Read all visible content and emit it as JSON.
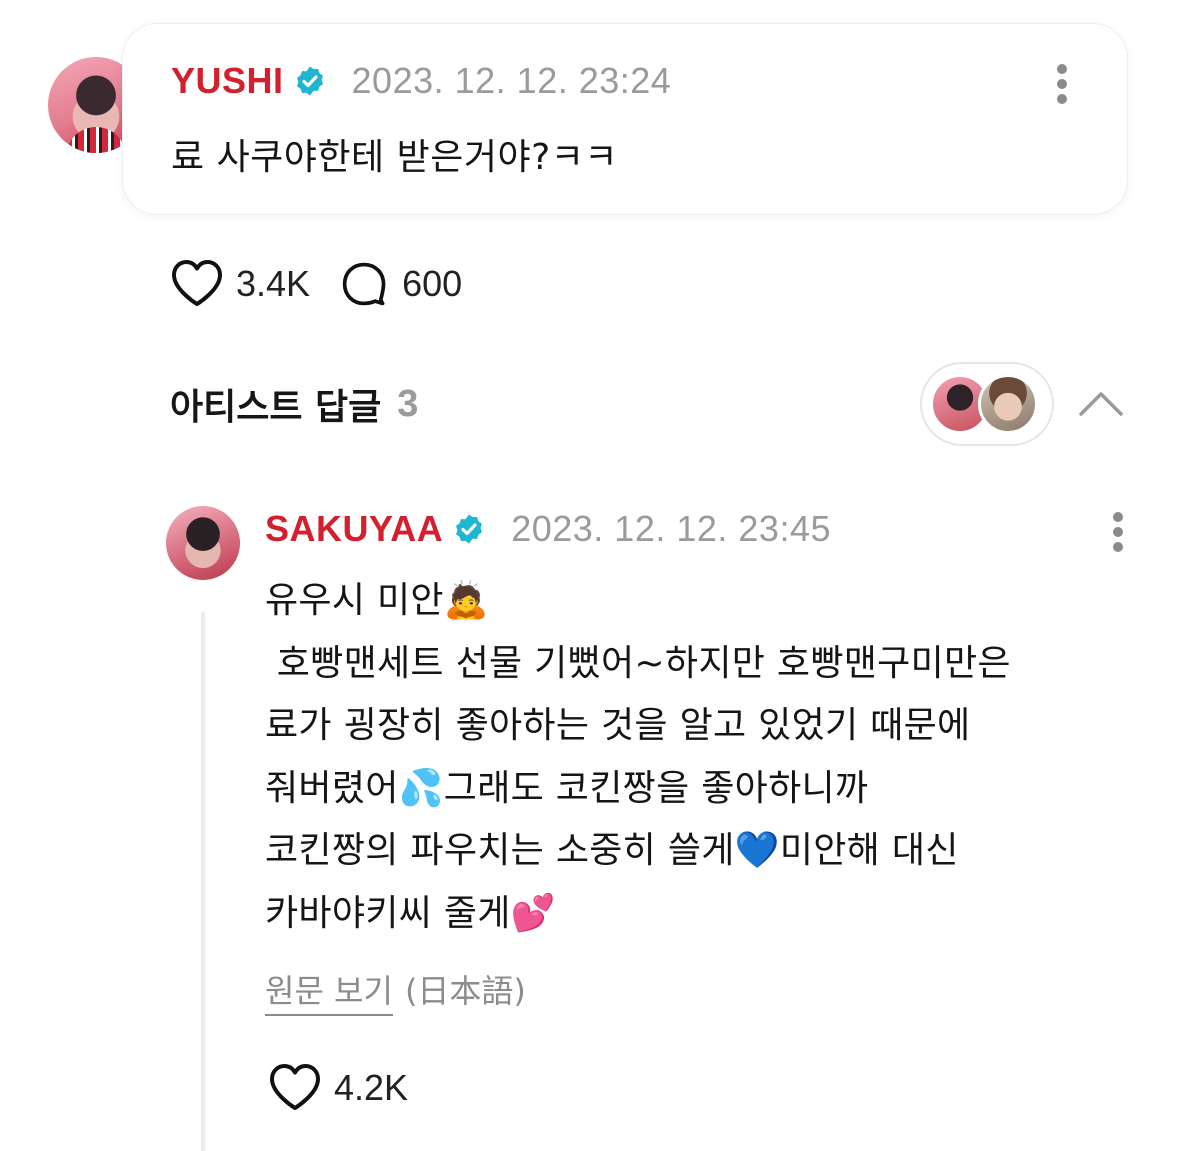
{
  "comment": {
    "author": "YUSHI",
    "timestamp": "2023. 12. 12. 23:24",
    "text": "료 사쿠야한테 받은거야?ㅋㅋ",
    "likes": "3.4K",
    "replies": "600"
  },
  "artist_replies": {
    "title": "아티스트 답글",
    "count": "3"
  },
  "reply": {
    "author": "SAKUYAA",
    "timestamp": "2023. 12. 12. 23:45",
    "lines": [
      "유우시 미안🙇",
      " 호빵맨세트 선물 기뻤어~하지만 호빵맨구미만은",
      "료가 굉장히 좋아하는 것을 알고 있었기 때문에",
      "줘버렸어💦그래도 코킨짱을 좋아하니까",
      "코킨짱의 파우치는 소중히 쓸게💙미안해 대신",
      "카바야키씨 줄게💕"
    ],
    "view_original": "원문 보기",
    "original_language": "(日本語)",
    "likes": "4.2K"
  },
  "colors": {
    "artist_name": "#d3202e",
    "verified_badge": "#1fb7cf",
    "muted_text": "#9a9a9a"
  },
  "icons": [
    "verified-badge-icon",
    "more-vertical-icon",
    "heart-icon",
    "comment-bubble-icon",
    "chevron-up-icon"
  ]
}
